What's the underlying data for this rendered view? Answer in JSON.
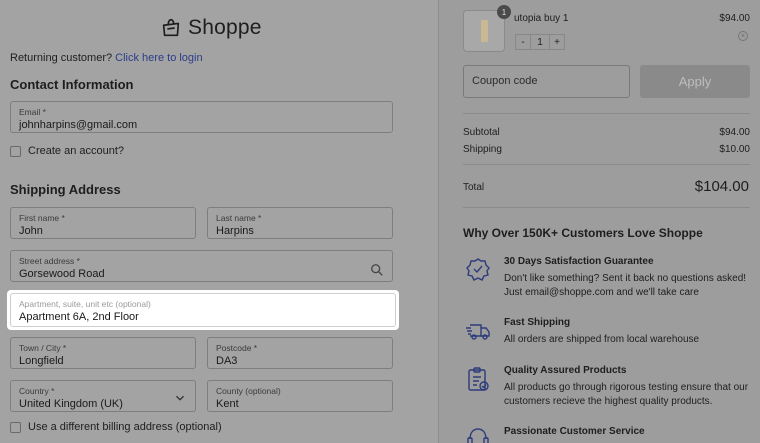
{
  "brand": {
    "name": "Shoppe"
  },
  "returning": {
    "text": "Returning customer?",
    "link": "Click here to login"
  },
  "contact": {
    "heading": "Contact Information",
    "email_label": "Email *",
    "email_value": "johnharpins@gmail.com",
    "create_account": "Create an account?"
  },
  "shipping": {
    "heading": "Shipping Address",
    "first_name_label": "First name *",
    "first_name_value": "John",
    "last_name_label": "Last name *",
    "last_name_value": "Harpins",
    "street_label": "Street address *",
    "street_value": "Gorsewood Road",
    "apartment_label": "Apartment, suite, unit etc (optional)",
    "apartment_value": "Apartment 6A, 2nd Floor",
    "town_label": "Town / City *",
    "town_value": "Longfield",
    "postcode_label": "Postcode *",
    "postcode_value": "DA3",
    "country_label": "Country *",
    "country_value": "United Kingdom (UK)",
    "county_label": "County (optional)",
    "county_value": "Kent",
    "billing_diff": "Use a different billing address (optional)"
  },
  "cart": {
    "badge": "1",
    "product_name": "utopia buy 1",
    "product_price": "$94.00",
    "qty_minus": "-",
    "qty": "1",
    "qty_plus": "+",
    "remove": "×"
  },
  "coupon": {
    "placeholder": "Coupon code",
    "apply": "Apply"
  },
  "summary": {
    "subtotal_label": "Subtotal",
    "subtotal_value": "$94.00",
    "shipping_label": "Shipping",
    "shipping_value": "$10.00",
    "total_label": "Total",
    "total_value": "$104.00"
  },
  "why": {
    "heading": "Why Over 150K+ Customers Love Shoppe",
    "features": [
      {
        "icon": "badge-check-icon",
        "title": "30 Days Satisfaction Guarantee",
        "desc": "Don't like something? Sent it back no questions asked! Just email@shoppe.com and we'll take care"
      },
      {
        "icon": "truck-icon",
        "title": "Fast Shipping",
        "desc": "All orders are shipped from local warehouse"
      },
      {
        "icon": "clipboard-check-icon",
        "title": "Quality Assured Products",
        "desc": "All products go through rigorous testing ensure that our customers recieve the highest quality products."
      },
      {
        "icon": "headset-icon",
        "title": "Passionate Customer Service",
        "desc": ""
      }
    ]
  }
}
